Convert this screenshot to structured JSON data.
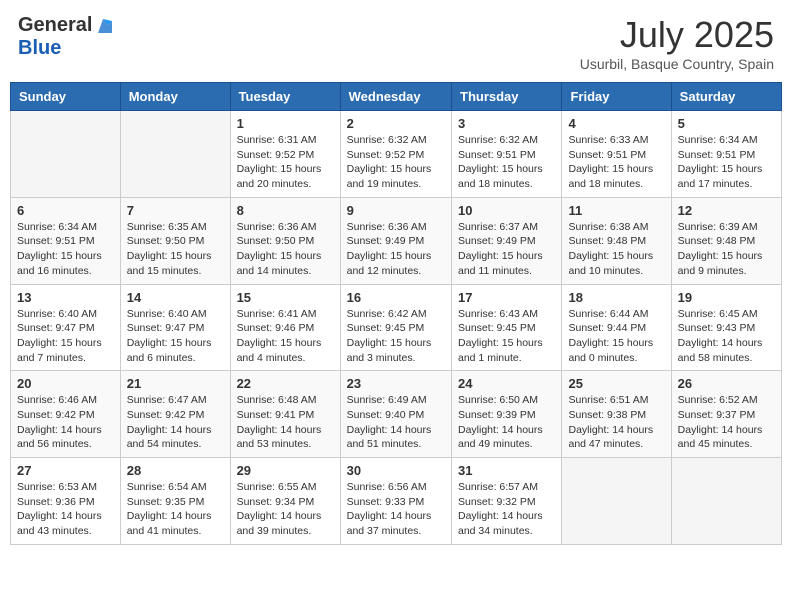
{
  "logo": {
    "general": "General",
    "blue": "Blue"
  },
  "title": "July 2025",
  "location": "Usurbil, Basque Country, Spain",
  "days_of_week": [
    "Sunday",
    "Monday",
    "Tuesday",
    "Wednesday",
    "Thursday",
    "Friday",
    "Saturday"
  ],
  "weeks": [
    [
      {
        "day": "",
        "info": ""
      },
      {
        "day": "",
        "info": ""
      },
      {
        "day": "1",
        "info": "Sunrise: 6:31 AM\nSunset: 9:52 PM\nDaylight: 15 hours\nand 20 minutes."
      },
      {
        "day": "2",
        "info": "Sunrise: 6:32 AM\nSunset: 9:52 PM\nDaylight: 15 hours\nand 19 minutes."
      },
      {
        "day": "3",
        "info": "Sunrise: 6:32 AM\nSunset: 9:51 PM\nDaylight: 15 hours\nand 18 minutes."
      },
      {
        "day": "4",
        "info": "Sunrise: 6:33 AM\nSunset: 9:51 PM\nDaylight: 15 hours\nand 18 minutes."
      },
      {
        "day": "5",
        "info": "Sunrise: 6:34 AM\nSunset: 9:51 PM\nDaylight: 15 hours\nand 17 minutes."
      }
    ],
    [
      {
        "day": "6",
        "info": "Sunrise: 6:34 AM\nSunset: 9:51 PM\nDaylight: 15 hours\nand 16 minutes."
      },
      {
        "day": "7",
        "info": "Sunrise: 6:35 AM\nSunset: 9:50 PM\nDaylight: 15 hours\nand 15 minutes."
      },
      {
        "day": "8",
        "info": "Sunrise: 6:36 AM\nSunset: 9:50 PM\nDaylight: 15 hours\nand 14 minutes."
      },
      {
        "day": "9",
        "info": "Sunrise: 6:36 AM\nSunset: 9:49 PM\nDaylight: 15 hours\nand 12 minutes."
      },
      {
        "day": "10",
        "info": "Sunrise: 6:37 AM\nSunset: 9:49 PM\nDaylight: 15 hours\nand 11 minutes."
      },
      {
        "day": "11",
        "info": "Sunrise: 6:38 AM\nSunset: 9:48 PM\nDaylight: 15 hours\nand 10 minutes."
      },
      {
        "day": "12",
        "info": "Sunrise: 6:39 AM\nSunset: 9:48 PM\nDaylight: 15 hours\nand 9 minutes."
      }
    ],
    [
      {
        "day": "13",
        "info": "Sunrise: 6:40 AM\nSunset: 9:47 PM\nDaylight: 15 hours\nand 7 minutes."
      },
      {
        "day": "14",
        "info": "Sunrise: 6:40 AM\nSunset: 9:47 PM\nDaylight: 15 hours\nand 6 minutes."
      },
      {
        "day": "15",
        "info": "Sunrise: 6:41 AM\nSunset: 9:46 PM\nDaylight: 15 hours\nand 4 minutes."
      },
      {
        "day": "16",
        "info": "Sunrise: 6:42 AM\nSunset: 9:45 PM\nDaylight: 15 hours\nand 3 minutes."
      },
      {
        "day": "17",
        "info": "Sunrise: 6:43 AM\nSunset: 9:45 PM\nDaylight: 15 hours\nand 1 minute."
      },
      {
        "day": "18",
        "info": "Sunrise: 6:44 AM\nSunset: 9:44 PM\nDaylight: 15 hours\nand 0 minutes."
      },
      {
        "day": "19",
        "info": "Sunrise: 6:45 AM\nSunset: 9:43 PM\nDaylight: 14 hours\nand 58 minutes."
      }
    ],
    [
      {
        "day": "20",
        "info": "Sunrise: 6:46 AM\nSunset: 9:42 PM\nDaylight: 14 hours\nand 56 minutes."
      },
      {
        "day": "21",
        "info": "Sunrise: 6:47 AM\nSunset: 9:42 PM\nDaylight: 14 hours\nand 54 minutes."
      },
      {
        "day": "22",
        "info": "Sunrise: 6:48 AM\nSunset: 9:41 PM\nDaylight: 14 hours\nand 53 minutes."
      },
      {
        "day": "23",
        "info": "Sunrise: 6:49 AM\nSunset: 9:40 PM\nDaylight: 14 hours\nand 51 minutes."
      },
      {
        "day": "24",
        "info": "Sunrise: 6:50 AM\nSunset: 9:39 PM\nDaylight: 14 hours\nand 49 minutes."
      },
      {
        "day": "25",
        "info": "Sunrise: 6:51 AM\nSunset: 9:38 PM\nDaylight: 14 hours\nand 47 minutes."
      },
      {
        "day": "26",
        "info": "Sunrise: 6:52 AM\nSunset: 9:37 PM\nDaylight: 14 hours\nand 45 minutes."
      }
    ],
    [
      {
        "day": "27",
        "info": "Sunrise: 6:53 AM\nSunset: 9:36 PM\nDaylight: 14 hours\nand 43 minutes."
      },
      {
        "day": "28",
        "info": "Sunrise: 6:54 AM\nSunset: 9:35 PM\nDaylight: 14 hours\nand 41 minutes."
      },
      {
        "day": "29",
        "info": "Sunrise: 6:55 AM\nSunset: 9:34 PM\nDaylight: 14 hours\nand 39 minutes."
      },
      {
        "day": "30",
        "info": "Sunrise: 6:56 AM\nSunset: 9:33 PM\nDaylight: 14 hours\nand 37 minutes."
      },
      {
        "day": "31",
        "info": "Sunrise: 6:57 AM\nSunset: 9:32 PM\nDaylight: 14 hours\nand 34 minutes."
      },
      {
        "day": "",
        "info": ""
      },
      {
        "day": "",
        "info": ""
      }
    ]
  ]
}
